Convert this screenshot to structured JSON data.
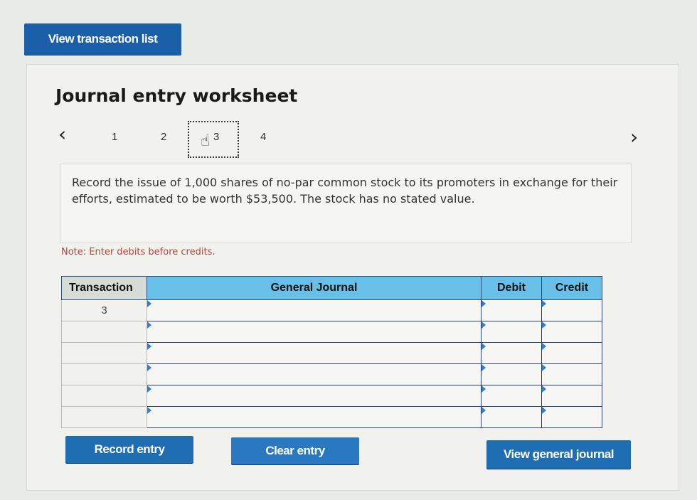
{
  "header": {
    "view_transaction_list": "View transaction list"
  },
  "worksheet": {
    "title": "Journal entry worksheet",
    "steps": [
      "1",
      "2",
      "3",
      "4"
    ],
    "current_step": "3",
    "description": "Record the issue of 1,000 shares of no-par common stock to its promoters in exchange for their efforts, estimated to be worth $53,500. The stock has no stated value.",
    "note": "Note: Enter debits before credits."
  },
  "table": {
    "headers": {
      "transaction": "Transaction",
      "general_journal": "General Journal",
      "debit": "Debit",
      "credit": "Credit"
    },
    "rows": [
      {
        "transaction": "3",
        "account": "",
        "debit": "",
        "credit": ""
      },
      {
        "transaction": "",
        "account": "",
        "debit": "",
        "credit": ""
      },
      {
        "transaction": "",
        "account": "",
        "debit": "",
        "credit": ""
      },
      {
        "transaction": "",
        "account": "",
        "debit": "",
        "credit": ""
      },
      {
        "transaction": "",
        "account": "",
        "debit": "",
        "credit": ""
      },
      {
        "transaction": "",
        "account": "",
        "debit": "",
        "credit": ""
      }
    ]
  },
  "buttons": {
    "record": "Record entry",
    "clear": "Clear entry",
    "view_general_journal": "View general journal"
  },
  "icons": {
    "prev": "chevron-left-icon",
    "next": "chevron-right-icon",
    "cursor": "hand-pointer-icon"
  },
  "colors": {
    "button_blue": "#1f6db3",
    "header_blue": "#68bfe8",
    "note_red": "#b0453c"
  }
}
